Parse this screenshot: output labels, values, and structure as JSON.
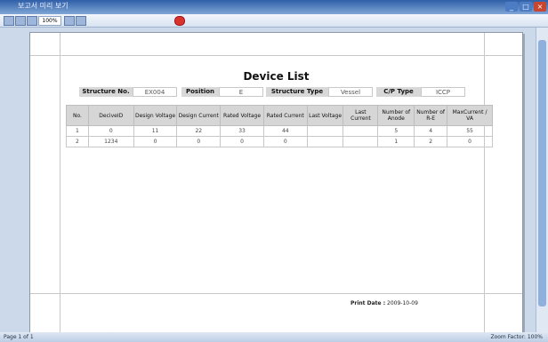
{
  "window": {
    "title": "보고서 미리 보기",
    "zoom": "100%"
  },
  "toolbar": {
    "zoom_value": "100%"
  },
  "report": {
    "title": "Device List",
    "info": [
      {
        "label": "Structure No.",
        "value": "EX004"
      },
      {
        "label": "Position",
        "value": "E"
      },
      {
        "label": "Structure Type",
        "value": "Vessel"
      },
      {
        "label": "C/P Type",
        "value": "ICCP"
      }
    ],
    "columns": [
      "No.",
      "DeciveID",
      "Design Voltage",
      "Design Current",
      "Rated Voltage",
      "Rated Current",
      "Last Voltage",
      "Last Current",
      "Number of Anode",
      "Number of R-E",
      "MaxCurrent / VA"
    ],
    "rows": [
      [
        "1",
        "0",
        "11",
        "22",
        "33",
        "44",
        "",
        "",
        "5",
        "4",
        "55"
      ],
      [
        "2",
        "1234",
        "0",
        "0",
        "0",
        "0",
        "",
        "",
        "1",
        "2",
        "0"
      ]
    ],
    "print_date_label": "Print Date :",
    "print_date": "2009-10-09"
  },
  "status": {
    "page": "Page 1 of 1",
    "zoom_factor": "Zoom Factor: 100%"
  }
}
